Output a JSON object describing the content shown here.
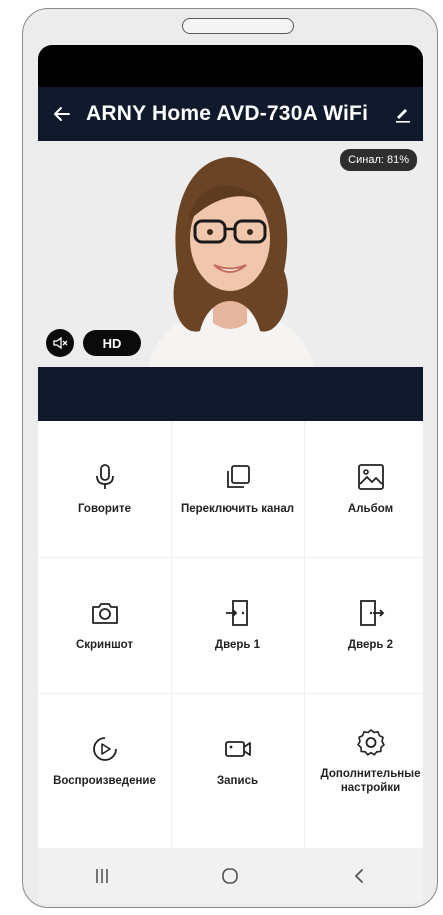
{
  "header": {
    "title": "ARNY Home AVD-730A WiFi"
  },
  "video": {
    "signal": "Синал: 81%",
    "quality": "HD"
  },
  "actions": [
    {
      "label": "Говорите",
      "icon": "microphone-icon"
    },
    {
      "label": "Переключить канал",
      "icon": "switch-channel-icon"
    },
    {
      "label": "Альбом",
      "icon": "album-image-icon"
    },
    {
      "label": "Скриншот",
      "icon": "camera-icon"
    },
    {
      "label": "Дверь 1",
      "icon": "door-icon"
    },
    {
      "label": "Дверь 2",
      "icon": "door-icon"
    },
    {
      "label": "Воспроизведение",
      "icon": "play-circle-icon"
    },
    {
      "label": "Запись",
      "icon": "video-camera-icon"
    },
    {
      "label": "Дополнительные настройки",
      "icon": "gear-icon"
    }
  ],
  "colors": {
    "appbar": "#111a2c",
    "statusbar": "#000000",
    "navbar": "#f1f1f1"
  }
}
